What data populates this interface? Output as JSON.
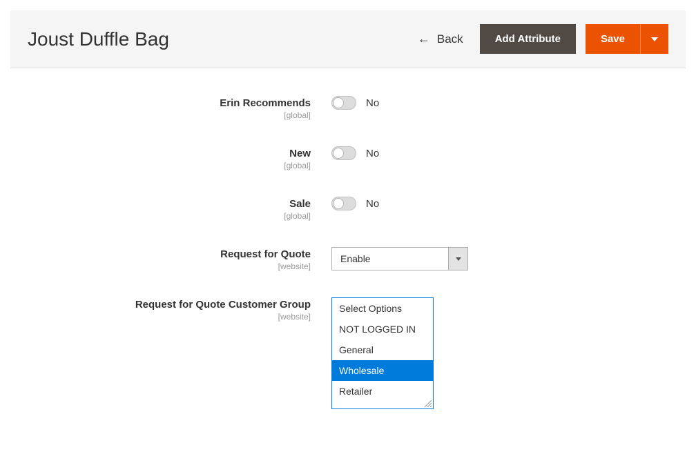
{
  "header": {
    "title": "Joust Duffle Bag",
    "back_label": "Back",
    "add_attribute_label": "Add Attribute",
    "save_label": "Save"
  },
  "fields": {
    "erin_recommends": {
      "label": "Erin Recommends",
      "scope": "[global]",
      "value_text": "No"
    },
    "new": {
      "label": "New",
      "scope": "[global]",
      "value_text": "No"
    },
    "sale": {
      "label": "Sale",
      "scope": "[global]",
      "value_text": "No"
    },
    "request_for_quote": {
      "label": "Request for Quote",
      "scope": "[website]",
      "selected": "Enable"
    },
    "rfq_customer_group": {
      "label": "Request for Quote Customer Group",
      "scope": "[website]",
      "options": [
        {
          "label": "Select Options",
          "selected": false
        },
        {
          "label": "NOT LOGGED IN",
          "selected": false
        },
        {
          "label": "General",
          "selected": false
        },
        {
          "label": "Wholesale",
          "selected": true
        },
        {
          "label": "Retailer",
          "selected": false
        }
      ]
    }
  }
}
